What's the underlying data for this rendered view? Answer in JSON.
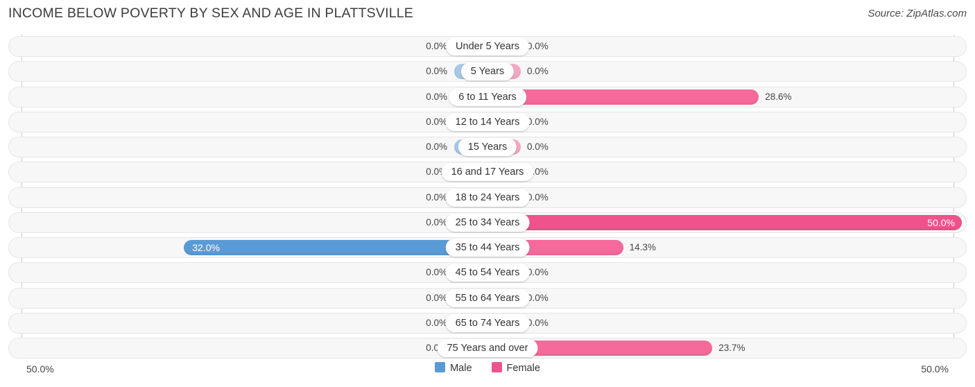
{
  "header": {
    "title": "INCOME BELOW POVERTY BY SEX AND AGE IN PLATTSVILLE",
    "source": "Source: ZipAtlas.com"
  },
  "footer": {
    "axis_left_label": "50.0%",
    "axis_right_label": "50.0%",
    "legend": [
      {
        "label": "Male",
        "color": "#5b9bd5"
      },
      {
        "label": "Female",
        "color": "#f0528c"
      }
    ]
  },
  "colors": {
    "male_zero": "#a8c8e8",
    "male_value": "#5b9bd5",
    "female_zero": "#f5a8c3",
    "female_value": "#f56a9a",
    "female_max": "#f0528c",
    "track_bg": "#f7f7f7",
    "track_border": "#e6e6e6",
    "axis": "#c9c9c9"
  },
  "chart_data": {
    "type": "bar",
    "subtype": "diverging-bidirectional",
    "title": "INCOME BELOW POVERTY BY SEX AND AGE IN PLATTSVILLE",
    "xlabel": "",
    "ylabel": "",
    "xlim": [
      -50.0,
      50.0
    ],
    "axis_tick_labels": [
      "50.0%",
      "50.0%"
    ],
    "grid": false,
    "legend_position": "bottom-center",
    "categories": [
      "Under 5 Years",
      "5 Years",
      "6 to 11 Years",
      "12 to 14 Years",
      "15 Years",
      "16 and 17 Years",
      "18 to 24 Years",
      "25 to 34 Years",
      "35 to 44 Years",
      "45 to 54 Years",
      "55 to 64 Years",
      "65 to 74 Years",
      "75 Years and over"
    ],
    "series": [
      {
        "name": "Male",
        "values": [
          0.0,
          0.0,
          0.0,
          0.0,
          0.0,
          0.0,
          0.0,
          0.0,
          32.0,
          0.0,
          0.0,
          0.0,
          0.0
        ],
        "labels": [
          "0.0%",
          "0.0%",
          "0.0%",
          "0.0%",
          "0.0%",
          "0.0%",
          "0.0%",
          "0.0%",
          "32.0%",
          "0.0%",
          "0.0%",
          "0.0%",
          "0.0%"
        ]
      },
      {
        "name": "Female",
        "values": [
          0.0,
          0.0,
          28.6,
          0.0,
          0.0,
          0.0,
          0.0,
          50.0,
          14.3,
          0.0,
          0.0,
          0.0,
          23.7
        ],
        "labels": [
          "0.0%",
          "0.0%",
          "28.6%",
          "0.0%",
          "0.0%",
          "0.0%",
          "0.0%",
          "50.0%",
          "14.3%",
          "0.0%",
          "0.0%",
          "0.0%",
          "23.7%"
        ]
      }
    ]
  }
}
